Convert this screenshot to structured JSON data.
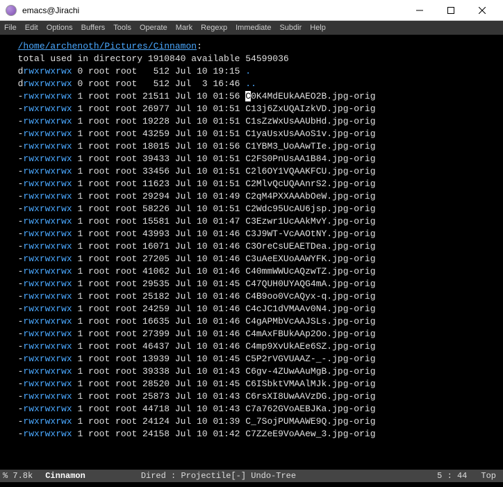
{
  "window": {
    "title": "emacs@Jirachi"
  },
  "menu": {
    "items": [
      "File",
      "Edit",
      "Options",
      "Buffers",
      "Tools",
      "Operate",
      "Mark",
      "Regexp",
      "Immediate",
      "Subdir",
      "Help"
    ]
  },
  "dired": {
    "path": "/home/archenoth/Pictures/Cinnamon",
    "summary": "total used in directory 1910840 available 54599036",
    "cursor_file_first_char": "C",
    "cursor_file_rest": "0K4MdEUkAAEO2B.jpg-orig",
    "entries": [
      {
        "perm": "drwxrwxrwx",
        "links": "0",
        "owner": "root",
        "group": "root",
        "size": "512",
        "month": "Jul",
        "day": "10",
        "time": "19:15",
        "name": ".",
        "isdir": true
      },
      {
        "perm": "drwxrwxrwx",
        "links": "0",
        "owner": "root",
        "group": "root",
        "size": "512",
        "month": "Jul",
        "day": " 3",
        "time": "16:46",
        "name": "..",
        "isdir": true
      },
      {
        "perm": "-rwxrwxrwx",
        "links": "1",
        "owner": "root",
        "group": "root",
        "size": "21511",
        "month": "Jul",
        "day": "10",
        "time": "01:56",
        "name": "C0K4MdEUkAAEO2B.jpg-orig",
        "cursor": true
      },
      {
        "perm": "-rwxrwxrwx",
        "links": "1",
        "owner": "root",
        "group": "root",
        "size": "26977",
        "month": "Jul",
        "day": "10",
        "time": "01:51",
        "name": "C13j6ZxUQAIzkVD.jpg-orig"
      },
      {
        "perm": "-rwxrwxrwx",
        "links": "1",
        "owner": "root",
        "group": "root",
        "size": "19228",
        "month": "Jul",
        "day": "10",
        "time": "01:51",
        "name": "C1sZzWxUsAAUbHd.jpg-orig"
      },
      {
        "perm": "-rwxrwxrwx",
        "links": "1",
        "owner": "root",
        "group": "root",
        "size": "43259",
        "month": "Jul",
        "day": "10",
        "time": "01:51",
        "name": "C1yaUsxUsAAoS1v.jpg-orig"
      },
      {
        "perm": "-rwxrwxrwx",
        "links": "1",
        "owner": "root",
        "group": "root",
        "size": "18015",
        "month": "Jul",
        "day": "10",
        "time": "01:56",
        "name": "C1YBM3_UoAAwTIe.jpg-orig"
      },
      {
        "perm": "-rwxrwxrwx",
        "links": "1",
        "owner": "root",
        "group": "root",
        "size": "39433",
        "month": "Jul",
        "day": "10",
        "time": "01:51",
        "name": "C2FS0PnUsAA1B84.jpg-orig"
      },
      {
        "perm": "-rwxrwxrwx",
        "links": "1",
        "owner": "root",
        "group": "root",
        "size": "33456",
        "month": "Jul",
        "day": "10",
        "time": "01:51",
        "name": "C2l6OY1VQAAKFCU.jpg-orig"
      },
      {
        "perm": "-rwxrwxrwx",
        "links": "1",
        "owner": "root",
        "group": "root",
        "size": "11623",
        "month": "Jul",
        "day": "10",
        "time": "01:51",
        "name": "C2MlvQcUQAAnrS2.jpg-orig"
      },
      {
        "perm": "-rwxrwxrwx",
        "links": "1",
        "owner": "root",
        "group": "root",
        "size": "29294",
        "month": "Jul",
        "day": "10",
        "time": "01:49",
        "name": "C2qM4PXXAAAbOeW.jpg-orig"
      },
      {
        "perm": "-rwxrwxrwx",
        "links": "1",
        "owner": "root",
        "group": "root",
        "size": "58226",
        "month": "Jul",
        "day": "10",
        "time": "01:51",
        "name": "C2Wdc95UcAU6jsp.jpg-orig"
      },
      {
        "perm": "-rwxrwxrwx",
        "links": "1",
        "owner": "root",
        "group": "root",
        "size": "15581",
        "month": "Jul",
        "day": "10",
        "time": "01:47",
        "name": "C3Ezwr1UcAAkMvY.jpg-orig"
      },
      {
        "perm": "-rwxrwxrwx",
        "links": "1",
        "owner": "root",
        "group": "root",
        "size": "43993",
        "month": "Jul",
        "day": "10",
        "time": "01:46",
        "name": "C3J9WT-VcAAOtNY.jpg-orig"
      },
      {
        "perm": "-rwxrwxrwx",
        "links": "1",
        "owner": "root",
        "group": "root",
        "size": "16071",
        "month": "Jul",
        "day": "10",
        "time": "01:46",
        "name": "C3OreCsUEAETDea.jpg-orig"
      },
      {
        "perm": "-rwxrwxrwx",
        "links": "1",
        "owner": "root",
        "group": "root",
        "size": "27205",
        "month": "Jul",
        "day": "10",
        "time": "01:46",
        "name": "C3uAeEXUoAAWYFK.jpg-orig"
      },
      {
        "perm": "-rwxrwxrwx",
        "links": "1",
        "owner": "root",
        "group": "root",
        "size": "41062",
        "month": "Jul",
        "day": "10",
        "time": "01:46",
        "name": "C40mmWWUcAQzwTZ.jpg-orig"
      },
      {
        "perm": "-rwxrwxrwx",
        "links": "1",
        "owner": "root",
        "group": "root",
        "size": "29535",
        "month": "Jul",
        "day": "10",
        "time": "01:45",
        "name": "C47QUH0UYAQG4mA.jpg-orig"
      },
      {
        "perm": "-rwxrwxrwx",
        "links": "1",
        "owner": "root",
        "group": "root",
        "size": "25182",
        "month": "Jul",
        "day": "10",
        "time": "01:46",
        "name": "C4B9oo0VcAQyx-q.jpg-orig"
      },
      {
        "perm": "-rwxrwxrwx",
        "links": "1",
        "owner": "root",
        "group": "root",
        "size": "24259",
        "month": "Jul",
        "day": "10",
        "time": "01:46",
        "name": "C4cJC1dVMAAv0N4.jpg-orig"
      },
      {
        "perm": "-rwxrwxrwx",
        "links": "1",
        "owner": "root",
        "group": "root",
        "size": "16635",
        "month": "Jul",
        "day": "10",
        "time": "01:46",
        "name": "C4gAPMbVcAAJSLs.jpg-orig"
      },
      {
        "perm": "-rwxrwxrwx",
        "links": "1",
        "owner": "root",
        "group": "root",
        "size": "27399",
        "month": "Jul",
        "day": "10",
        "time": "01:46",
        "name": "C4mAxFBUkAAp2Oo.jpg-orig"
      },
      {
        "perm": "-rwxrwxrwx",
        "links": "1",
        "owner": "root",
        "group": "root",
        "size": "46437",
        "month": "Jul",
        "day": "10",
        "time": "01:46",
        "name": "C4mp9XvUkAEe6SZ.jpg-orig"
      },
      {
        "perm": "-rwxrwxrwx",
        "links": "1",
        "owner": "root",
        "group": "root",
        "size": "13939",
        "month": "Jul",
        "day": "10",
        "time": "01:45",
        "name": "C5P2rVGVUAAZ-_-.jpg-orig"
      },
      {
        "perm": "-rwxrwxrwx",
        "links": "1",
        "owner": "root",
        "group": "root",
        "size": "39338",
        "month": "Jul",
        "day": "10",
        "time": "01:43",
        "name": "C6gv-4ZUwAAuMgB.jpg-orig"
      },
      {
        "perm": "-rwxrwxrwx",
        "links": "1",
        "owner": "root",
        "group": "root",
        "size": "28520",
        "month": "Jul",
        "day": "10",
        "time": "01:45",
        "name": "C6ISbktVMAAlMJk.jpg-orig"
      },
      {
        "perm": "-rwxrwxrwx",
        "links": "1",
        "owner": "root",
        "group": "root",
        "size": "25873",
        "month": "Jul",
        "day": "10",
        "time": "01:43",
        "name": "C6rsXI8UwAAVzDG.jpg-orig"
      },
      {
        "perm": "-rwxrwxrwx",
        "links": "1",
        "owner": "root",
        "group": "root",
        "size": "44718",
        "month": "Jul",
        "day": "10",
        "time": "01:43",
        "name": "C7a762GVoAEBJKa.jpg-orig"
      },
      {
        "perm": "-rwxrwxrwx",
        "links": "1",
        "owner": "root",
        "group": "root",
        "size": "24124",
        "month": "Jul",
        "day": "10",
        "time": "01:39",
        "name": "C_7SojPUMAAWE9Q.jpg-orig"
      },
      {
        "perm": "-rwxrwxrwx",
        "links": "1",
        "owner": "root",
        "group": "root",
        "size": "24158",
        "month": "Jul",
        "day": "10",
        "time": "01:42",
        "name": "C7ZZeE9VoAAew_3.jpg-orig"
      }
    ]
  },
  "modeline": {
    "percent": "% 7.8k",
    "buffer": "Cinnamon",
    "mode": "Dired : Projectile[-] Undo-Tree",
    "position": "5 : 44",
    "scroll": "Top"
  }
}
